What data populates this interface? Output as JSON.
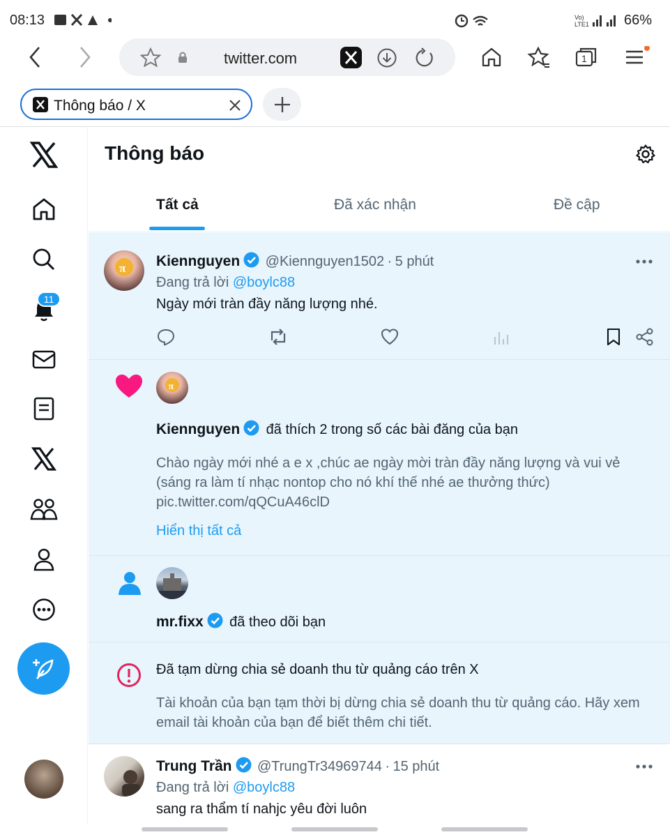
{
  "status_bar": {
    "time": "08:13",
    "battery": "66%"
  },
  "browser": {
    "url": "twitter.com",
    "tab_title": "Thông báo / X",
    "tab_count": "1"
  },
  "sidebar": {
    "notification_badge": "11"
  },
  "header": {
    "title": "Thông báo"
  },
  "tabs": [
    {
      "label": "Tất cả",
      "active": true
    },
    {
      "label": "Đã xác nhận",
      "active": false
    },
    {
      "label": "Đề cập",
      "active": false
    }
  ],
  "notifications": {
    "reply1": {
      "name": "Kiennguyen",
      "handle": "@Kiennguyen1502",
      "separator": "·",
      "time": "5 phút",
      "replying_prefix": "Đang trả lời",
      "replying_to": "@boylc88",
      "text": "Ngày mới tràn đầy năng lượng nhé."
    },
    "like": {
      "name": "Kiennguyen",
      "action": "đã thích 2 trong số các bài đăng của bạn",
      "post_text": "Chào ngày mới nhé a e x ,chúc ae ngày mời tràn đầy năng lượng và vui vẻ (sáng ra làm tí nhạc nontop cho nó khí thế nhé ae thưởng thức) pic.twitter.com/qQCuA46clD",
      "show_all": "Hiển thị tất cả"
    },
    "follow": {
      "name": "mr.fixx",
      "action": "đã theo dõi bạn"
    },
    "alert": {
      "title": "Đã tạm dừng chia sẻ doanh thu từ quảng cáo trên X",
      "body": "Tài khoản của bạn tạm thời bị dừng chia sẻ doanh thu từ quảng cáo. Hãy xem email tài khoản của bạn để biết thêm chi tiết."
    },
    "reply2": {
      "name": "Trung Trần",
      "handle": "@TrungTr34969744",
      "separator": "·",
      "time": "15 phút",
      "replying_prefix": "Đang trả lời",
      "replying_to": "@boylc88",
      "text": "sang ra thẩm tí nahjc yêu đời luôn"
    }
  },
  "colors": {
    "accent": "#1d9bf0",
    "like": "#f91880",
    "alert": "#e0245e",
    "highlight_bg": "#e8f5fd"
  }
}
